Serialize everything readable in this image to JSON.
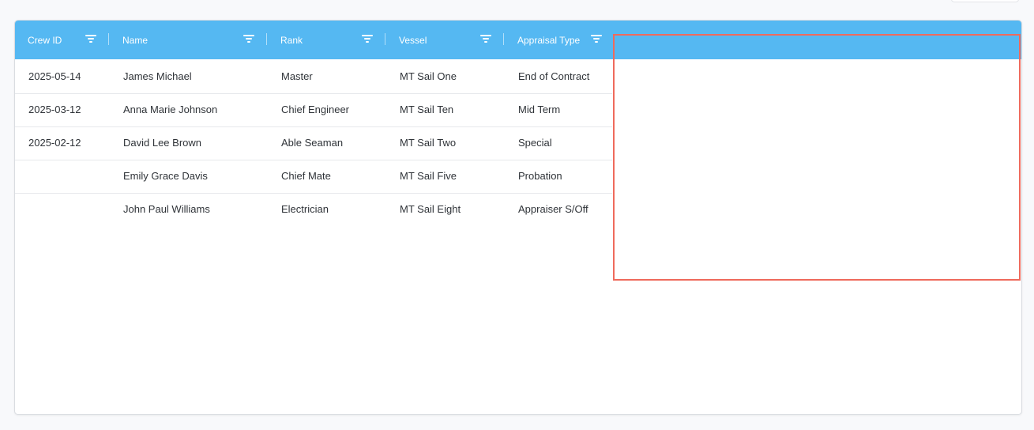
{
  "columns": [
    {
      "label": "Crew ID",
      "key": "crew_id"
    },
    {
      "label": "Name",
      "key": "name"
    },
    {
      "label": "Rank",
      "key": "rank"
    },
    {
      "label": "Vessel",
      "key": "vessel"
    },
    {
      "label": "Appraisal Type",
      "key": "appraisal_type"
    }
  ],
  "rows": [
    {
      "crew_id": "2025-05-14",
      "name": "James Michael",
      "rank": "Master",
      "vessel": "MT Sail One",
      "appraisal_type": "End of Contract"
    },
    {
      "crew_id": "2025-03-12",
      "name": "Anna Marie Johnson",
      "rank": "Chief Engineer",
      "vessel": "MT Sail Ten",
      "appraisal_type": "Mid Term"
    },
    {
      "crew_id": "2025-02-12",
      "name": "David Lee Brown",
      "rank": "Able Seaman",
      "vessel": "MT Sail Two",
      "appraisal_type": "Special"
    },
    {
      "crew_id": "",
      "name": "Emily Grace Davis",
      "rank": "Chief Mate",
      "vessel": "MT Sail Five",
      "appraisal_type": "Probation"
    },
    {
      "crew_id": "",
      "name": "John Paul Williams",
      "rank": "Electrician",
      "vessel": "MT Sail Eight",
      "appraisal_type": "Appraiser S/Off"
    }
  ],
  "icons": {
    "column_filter": "filter-icon"
  },
  "colors": {
    "header_bg": "#55b8f2",
    "highlight": "#ef6a5c"
  }
}
